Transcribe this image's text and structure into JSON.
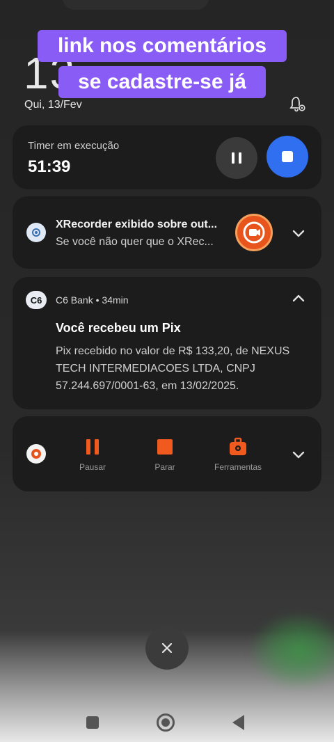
{
  "lockscreen": {
    "clock": "13",
    "date": "Qui, 13/Fev"
  },
  "overlay": {
    "line1": "link nos comentários",
    "line2": "se cadastre-se já"
  },
  "timer_notification": {
    "label": "Timer em execução",
    "value": "51:39"
  },
  "xrecorder_notification": {
    "title": "XRecorder exibido sobre out...",
    "body": "Se você não quer que o XRec..."
  },
  "c6_notification": {
    "logo_text": "C6",
    "app": "C6 Bank • 34min",
    "title": "Você recebeu um Pix",
    "body": "Pix recebido no valor de R$ 133,20, de NEXUS TECH INTERMEDIACOES LTDA, CNPJ 57.244.697/0001-63, em 13/02/2025."
  },
  "recorder_controls": {
    "pause_label": "Pausar",
    "stop_label": "Parar",
    "tools_label": "Ferramentas"
  },
  "colors": {
    "accent_blue": "#2f6ff0",
    "overlay_purple": "#8a5cf6",
    "recorder_orange": "#e8551c"
  }
}
